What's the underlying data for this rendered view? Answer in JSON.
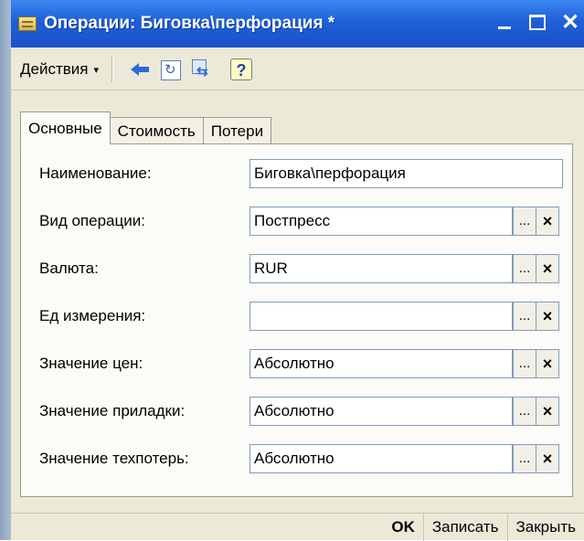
{
  "window": {
    "title": "Операции: Биговка\\перфорация *",
    "title_icon": "document-icon",
    "controls": {
      "minimize": "_",
      "maximize": "□",
      "close": "✕"
    }
  },
  "toolbar": {
    "actions_label": "Действия",
    "actions_arrow": "▾",
    "icons": [
      "back-arrow-icon",
      "refresh-doc-icon",
      "swap-icon",
      "help-icon"
    ],
    "help_glyph": "?"
  },
  "tabs": [
    {
      "label": "Основные",
      "active": true
    },
    {
      "label": "Стоимость",
      "active": false
    },
    {
      "label": "Потери",
      "active": false
    }
  ],
  "form": {
    "fields": [
      {
        "label": "Наименование:",
        "value": "Биговка\\перфорация",
        "has_buttons": false
      },
      {
        "label": "Вид операции:",
        "value": "Постпресс",
        "has_buttons": true
      },
      {
        "label": "Валюта:",
        "value": "RUR",
        "has_buttons": true
      },
      {
        "label": "Ед измерения:",
        "value": "",
        "has_buttons": true
      },
      {
        "label": "Значение цен:",
        "value": "Абсолютно",
        "has_buttons": true
      },
      {
        "label": "Значение приладки:",
        "value": "Абсолютно",
        "has_buttons": true
      },
      {
        "label": "Значение техпотерь:",
        "value": "Абсолютно",
        "has_buttons": true
      }
    ],
    "select_button_label": "...",
    "clear_button_label": "×"
  },
  "footer": {
    "ok_label": "OK",
    "save_label": "Записать",
    "close_label": "Закрыть"
  },
  "colors": {
    "titlebar": "#1f5fd8",
    "window_bg": "#ece9d8",
    "field_border": "#7f9db9"
  }
}
